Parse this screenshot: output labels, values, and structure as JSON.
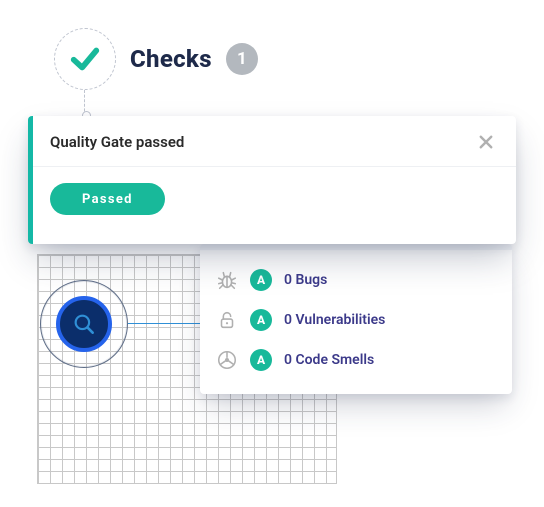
{
  "header": {
    "title": "Checks",
    "count": "1"
  },
  "card": {
    "title": "Quality Gate passed",
    "status_label": "Passed"
  },
  "metrics": [
    {
      "grade": "A",
      "count": "0",
      "label": "Bugs"
    },
    {
      "grade": "A",
      "count": "0",
      "label": "Vulnerabilities"
    },
    {
      "grade": "A",
      "count": "0",
      "label": "Code Smells"
    }
  ],
  "icons": {
    "check": "check-icon",
    "close": "close-icon",
    "magnify": "magnify-icon",
    "bug": "bug-icon",
    "lock": "unlock-icon",
    "smell": "radiation-icon"
  },
  "colors": {
    "teal": "#18b99a",
    "navy": "#1e2a4a",
    "purple": "#3c3a8a"
  }
}
